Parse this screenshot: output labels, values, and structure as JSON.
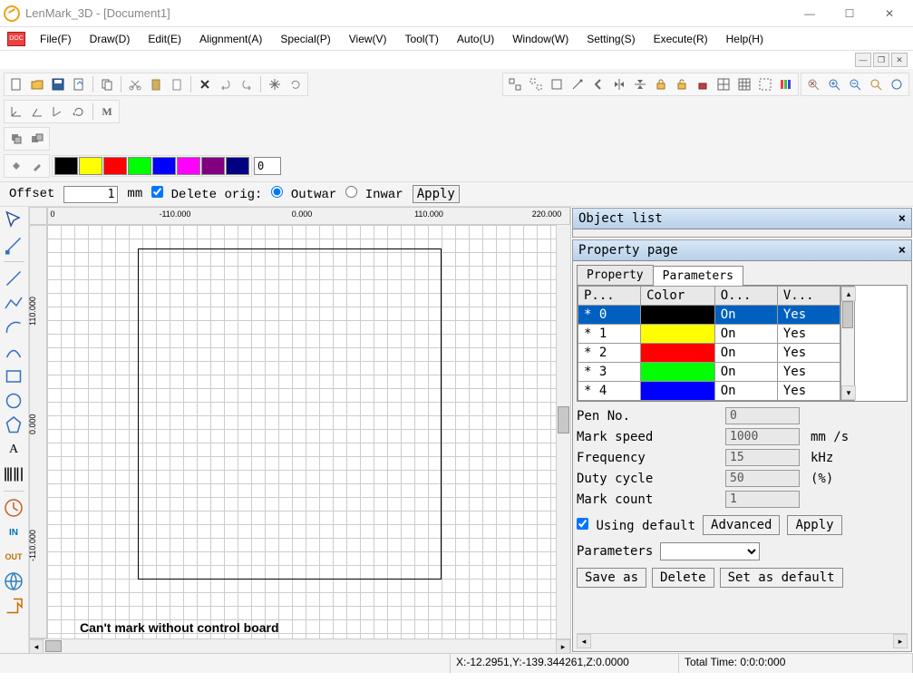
{
  "window": {
    "title": "LenMark_3D - [Document1]"
  },
  "menu": [
    "File(F)",
    "Draw(D)",
    "Edit(E)",
    "Alignment(A)",
    "Special(P)",
    "View(V)",
    "Tool(T)",
    "Auto(U)",
    "Window(W)",
    "Setting(S)",
    "Execute(R)",
    "Help(H)"
  ],
  "swatches": [
    "#000000",
    "#ffff00",
    "#ff0000",
    "#00ff00",
    "#0000ff",
    "#ff00ff",
    "#800080",
    "#000080"
  ],
  "swatch_input": "0",
  "offset": {
    "label": "Offset",
    "value": "1",
    "unit": "mm",
    "delete_orig": "Delete orig:",
    "delete_orig_checked": true,
    "outward": "Outwar",
    "inward": "Inwar",
    "direction": "outward",
    "apply": "Apply"
  },
  "ruler_h": [
    {
      "label": "0",
      "pos": 5
    },
    {
      "label": "-110.000",
      "pos": 140
    },
    {
      "label": "0.000",
      "pos": 280
    },
    {
      "label": "110.000",
      "pos": 420
    },
    {
      "label": "220.000",
      "pos": 550
    }
  ],
  "ruler_v": [
    {
      "label": "110.000",
      "pos": 100
    },
    {
      "label": "0.000",
      "pos": 220
    },
    {
      "label": "-110.000",
      "pos": 360
    }
  ],
  "canvas_msg": "Can't mark without control board",
  "object_list": {
    "title": "Object list"
  },
  "property_page": {
    "title": "Property page",
    "tabs": [
      "Property",
      "Parameters"
    ],
    "active_tab": 1,
    "headers": [
      "P...",
      "Color",
      "O...",
      "V..."
    ],
    "rows": [
      {
        "idx": "*  0",
        "color": "#000000",
        "on": "On",
        "yes": "Yes",
        "sel": true
      },
      {
        "idx": "*  1",
        "color": "#ffff00",
        "on": "On",
        "yes": "Yes",
        "sel": false
      },
      {
        "idx": "*  2",
        "color": "#ff0000",
        "on": "On",
        "yes": "Yes",
        "sel": false
      },
      {
        "idx": "*  3",
        "color": "#00ff00",
        "on": "On",
        "yes": "Yes",
        "sel": false
      },
      {
        "idx": "*  4",
        "color": "#0000ff",
        "on": "On",
        "yes": "Yes",
        "sel": false
      }
    ],
    "fields": {
      "pen_no": {
        "label": "Pen No.",
        "value": "0",
        "unit": ""
      },
      "mark_speed": {
        "label": "Mark speed",
        "value": "1000",
        "unit": "mm /s"
      },
      "frequency": {
        "label": "Frequency",
        "value": "15",
        "unit": "kHz"
      },
      "duty_cycle": {
        "label": "Duty cycle",
        "value": "50",
        "unit": "(%)"
      },
      "mark_count": {
        "label": "Mark count",
        "value": "1",
        "unit": ""
      }
    },
    "using_default": "Using default",
    "using_default_checked": true,
    "advanced": "Advanced",
    "apply": "Apply",
    "parameters_label": "Parameters",
    "save_as": "Save as",
    "delete": "Delete",
    "set_as_default": "Set as default"
  },
  "status": {
    "coords": "X:-12.2951,Y:-139.344261,Z:0.0000",
    "total_time": "Total Time: 0:0:0:000"
  }
}
